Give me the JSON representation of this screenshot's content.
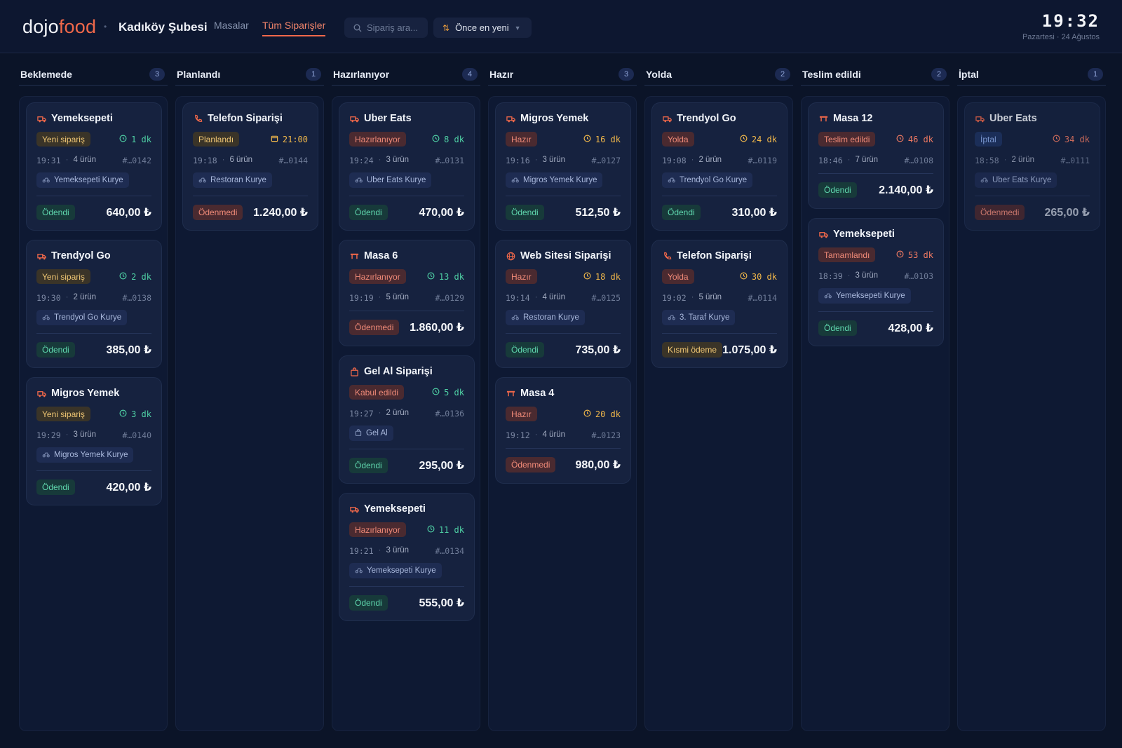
{
  "header": {
    "logo_part1": "dojo",
    "logo_part2": "food",
    "branch": "Kadıköy Şubesi",
    "nav": [
      {
        "label": "Masalar"
      },
      {
        "label": "Tüm Siparişler"
      }
    ],
    "search_placeholder": "Sipariş ara...",
    "sort_label": "Önce en yeni",
    "time": "19:32",
    "date": "Pazartesi · 24 Ağustos"
  },
  "colors": {
    "accent": "#f0684a",
    "background": "#0b1428",
    "card": "#16223f",
    "paid": "#5fd6ad",
    "unpaid": "#f08a78",
    "warning": "#f0c774"
  },
  "columns": [
    {
      "title": "Beklemede",
      "count": "3",
      "cards": [
        {
          "title": "Yemeksepeti",
          "icon": "truck-icon",
          "status": "Yeni sipariş",
          "timer": "1 dk",
          "time": "19:31",
          "items": "4 ürün",
          "order_id": "#…0142",
          "courier": "Yemeksepeti Kurye",
          "payment": "Ödendi",
          "amount": "640,00 ₺"
        },
        {
          "title": "Trendyol Go",
          "icon": "truck-icon",
          "status": "Yeni sipariş",
          "timer": "2 dk",
          "time": "19:30",
          "items": "2 ürün",
          "order_id": "#…0138",
          "courier": "Trendyol Go Kurye",
          "payment": "Ödendi",
          "amount": "385,00 ₺"
        },
        {
          "title": "Migros Yemek",
          "icon": "truck-icon",
          "status": "Yeni sipariş",
          "timer": "3 dk",
          "time": "19:29",
          "items": "3 ürün",
          "order_id": "#…0140",
          "courier": "Migros Yemek Kurye",
          "payment": "Ödendi",
          "amount": "420,00 ₺"
        }
      ]
    },
    {
      "title": "Planlandı",
      "count": "1",
      "cards": [
        {
          "title": "Telefon Siparişi",
          "icon": "phone-icon",
          "status": "Planlandı",
          "timer": "21:00",
          "time": "19:18",
          "items": "6 ürün",
          "order_id": "#…0144",
          "courier": "Restoran Kurye",
          "payment": "Ödenmedi",
          "amount": "1.240,00 ₺"
        }
      ]
    },
    {
      "title": "Hazırlanıyor",
      "count": "4",
      "cards": [
        {
          "title": "Uber Eats",
          "icon": "truck-icon",
          "status": "Hazırlanıyor",
          "timer": "8 dk",
          "time": "19:24",
          "items": "3 ürün",
          "order_id": "#…0131",
          "courier": "Uber Eats Kurye",
          "payment": "Ödendi",
          "amount": "470,00 ₺"
        },
        {
          "title": "Masa 6",
          "icon": "table-icon",
          "status": "Hazırlanıyor",
          "timer": "13 dk",
          "time": "19:19",
          "items": "5 ürün",
          "order_id": "#…0129",
          "payment": "Ödenmedi",
          "amount": "1.860,00 ₺"
        },
        {
          "title": "Gel Al Siparişi",
          "icon": "bag-icon",
          "status": "Kabul edildi",
          "timer": "5 dk",
          "time": "19:27",
          "items": "2 ürün",
          "order_id": "#…0136",
          "courier": "Gel Al",
          "payment": "Ödendi",
          "amount": "295,00 ₺"
        },
        {
          "title": "Yemeksepeti",
          "icon": "truck-icon",
          "status": "Hazırlanıyor",
          "timer": "11 dk",
          "time": "19:21",
          "items": "3 ürün",
          "order_id": "#…0134",
          "courier": "Yemeksepeti Kurye",
          "payment": "Ödendi",
          "amount": "555,00 ₺"
        }
      ]
    },
    {
      "title": "Hazır",
      "count": "3",
      "cards": [
        {
          "title": "Migros Yemek",
          "icon": "truck-icon",
          "status": "Hazır",
          "timer": "16 dk",
          "time": "19:16",
          "items": "3 ürün",
          "order_id": "#…0127",
          "courier": "Migros Yemek Kurye",
          "payment": "Ödendi",
          "amount": "512,50 ₺"
        },
        {
          "title": "Web Sitesi Siparişi",
          "icon": "globe-icon",
          "status": "Hazır",
          "timer": "18 dk",
          "time": "19:14",
          "items": "4 ürün",
          "order_id": "#…0125",
          "courier": "Restoran Kurye",
          "payment": "Ödendi",
          "amount": "735,00 ₺"
        },
        {
          "title": "Masa 4",
          "icon": "table-icon",
          "status": "Hazır",
          "timer": "20 dk",
          "time": "19:12",
          "items": "4 ürün",
          "order_id": "#…0123",
          "payment": "Ödenmedi",
          "amount": "980,00 ₺"
        }
      ]
    },
    {
      "title": "Yolda",
      "count": "2",
      "cards": [
        {
          "title": "Trendyol Go",
          "icon": "truck-icon",
          "status": "Yolda",
          "timer": "24 dk",
          "time": "19:08",
          "items": "2 ürün",
          "order_id": "#…0119",
          "courier": "Trendyol Go Kurye",
          "payment": "Ödendi",
          "amount": "310,00 ₺"
        },
        {
          "title": "Telefon Siparişi",
          "icon": "phone-icon",
          "status": "Yolda",
          "timer": "30 dk",
          "time": "19:02",
          "items": "5 ürün",
          "order_id": "#…0114",
          "courier": "3. Taraf Kurye",
          "payment": "Kısmi ödeme",
          "amount": "1.075,00 ₺"
        }
      ]
    },
    {
      "title": "Teslim edildi",
      "count": "2",
      "cards": [
        {
          "title": "Masa 12",
          "icon": "table-icon",
          "status": "Teslim edildi",
          "timer": "46 dk",
          "time": "18:46",
          "items": "7 ürün",
          "order_id": "#…0108",
          "payment": "Ödendi",
          "amount": "2.140,00 ₺"
        },
        {
          "title": "Yemeksepeti",
          "icon": "truck-icon",
          "status": "Tamamlandı",
          "timer": "53 dk",
          "time": "18:39",
          "items": "3 ürün",
          "order_id": "#…0103",
          "courier": "Yemeksepeti Kurye",
          "payment": "Ödendi",
          "amount": "428,00 ₺"
        }
      ]
    },
    {
      "title": "İptal",
      "count": "1",
      "cards": [
        {
          "title": "Uber Eats",
          "icon": "truck-icon",
          "status": "İptal",
          "timer": "34 dk",
          "time": "18:58",
          "items": "2 ürün",
          "order_id": "#…0111",
          "courier": "Uber Eats Kurye",
          "payment": "Ödenmedi",
          "amount": "265,00 ₺"
        }
      ]
    }
  ]
}
